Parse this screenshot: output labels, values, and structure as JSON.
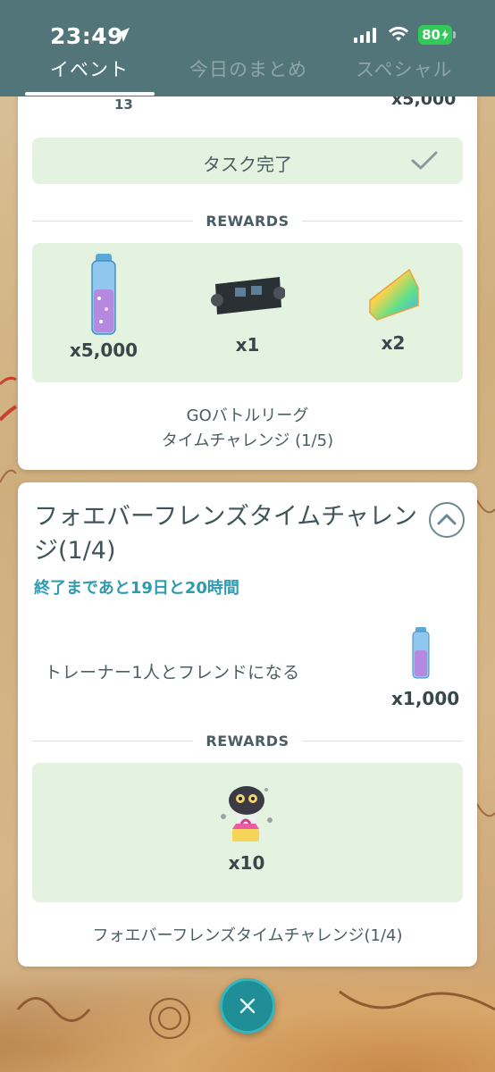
{
  "status_bar": {
    "time": "23:49",
    "battery": "80"
  },
  "tabs": [
    {
      "label": "イベント",
      "active": true
    },
    {
      "label": "今日のまとめ",
      "active": false
    },
    {
      "label": "スペシャル",
      "active": false
    }
  ],
  "card1": {
    "peek_left": "13",
    "peek_right": "x5,000",
    "task_done_label": "タスク完了",
    "rewards_label": "REWARDS",
    "rewards": [
      {
        "icon": "stardust-icon",
        "qty": "x5,000"
      },
      {
        "icon": "battle-map-icon",
        "qty": "x1"
      },
      {
        "icon": "rare-candy-icon",
        "qty": "x2"
      }
    ],
    "footer_line1": "GOバトルリーグ",
    "footer_line2": "タイムチャレンジ (1/5)"
  },
  "card2": {
    "title": "フォエバーフレンズタイムチャレンジ(1/4)",
    "subtitle": "終了まであと19日と20時間",
    "task": "トレーナー1人とフレンドになる",
    "task_reward_qty": "x1,000",
    "rewards_label": "REWARDS",
    "rewards": [
      {
        "icon": "pokemon-encounter-icon",
        "qty": "x10"
      }
    ],
    "footer": "フォエバーフレンズタイムチャレンジ(1/4)"
  },
  "colors": {
    "header": "#52757a",
    "reward_bg": "#e4f3e0",
    "accent_teal": "#2e9bb0"
  }
}
